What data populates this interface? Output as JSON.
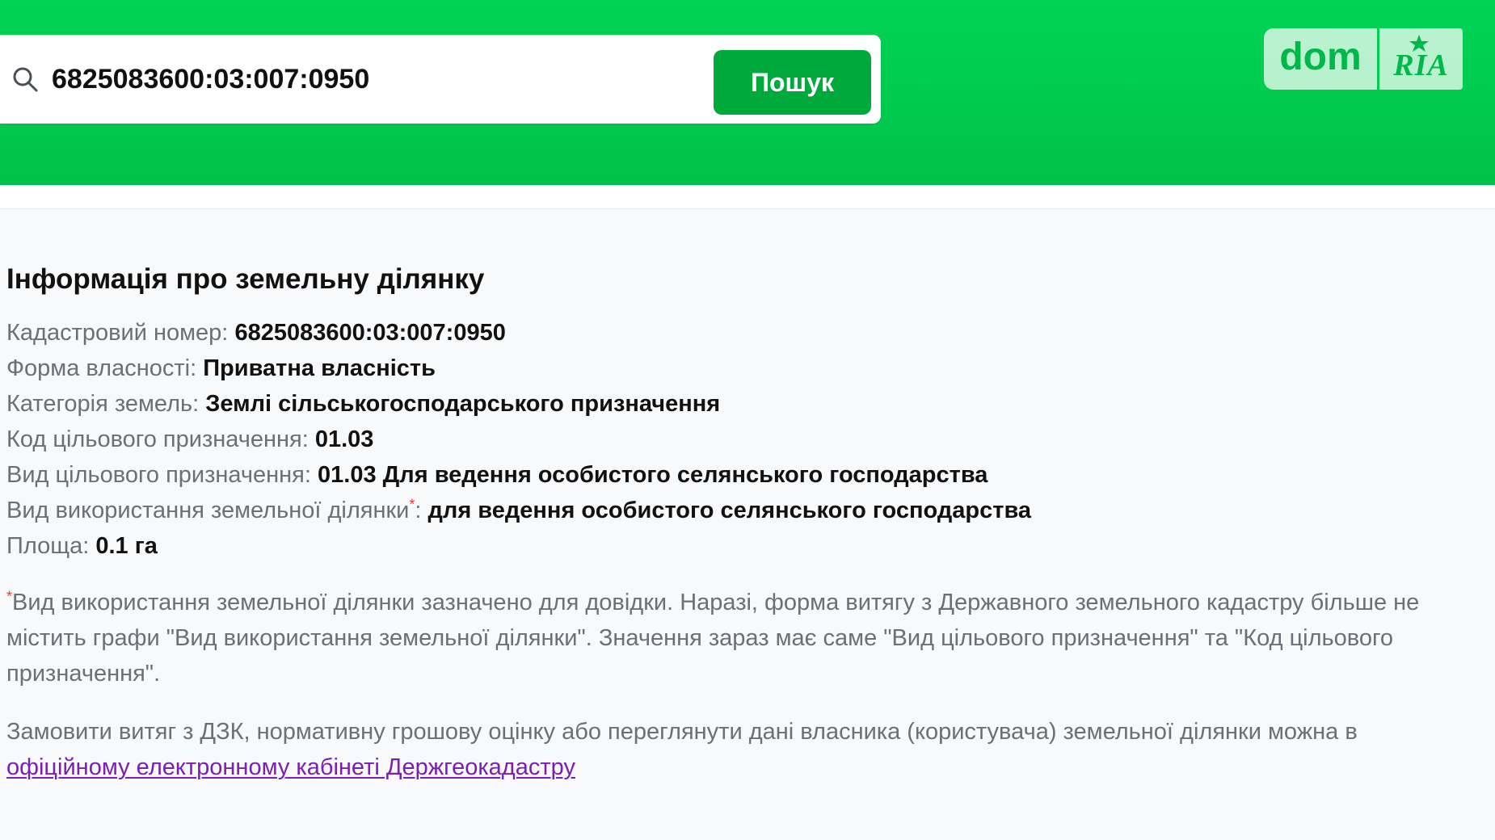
{
  "colors": {
    "header_green": "#00c94e",
    "button_green": "#00a93c",
    "link_purple": "#7a1fb4",
    "asterisk_red": "#e23b3b"
  },
  "search": {
    "value": "6825083600:03:007:0950",
    "button_label": "Пошук",
    "icon": "search-icon"
  },
  "logo": {
    "dom": "dom",
    "ria": "RIA",
    "icon": "star-icon"
  },
  "page": {
    "title": "Інформація про земельну ділянку"
  },
  "info": {
    "rows": [
      {
        "label": "Кадастровий номер: ",
        "value": "6825083600:03:007:0950"
      },
      {
        "label": "Форма власності: ",
        "value": "Приватна власність"
      },
      {
        "label": "Категорія земель: ",
        "value": "Землі сільськогосподарського призначення"
      },
      {
        "label": "Код цільового призначення: ",
        "value": "01.03"
      },
      {
        "label": "Вид цільового призначення: ",
        "value": "01.03 Для ведення особистого селянського господарства"
      },
      {
        "label": "Вид використання земельної ділянки",
        "marker": "*",
        "suffix": ": ",
        "value": "для ведення особистого селянського господарства"
      },
      {
        "label": "Площа: ",
        "value": "0.1 га"
      }
    ]
  },
  "footnote": {
    "marker": "*",
    "text": "Вид використання земельної ділянки зазначено для довідки. Наразі, форма витягу з Державного земельного кадастру більше не містить графи \"Вид використання земельної ділянки\". Значення зараз має саме \"Вид цільового призначення\" та \"Код цільового призначення\"."
  },
  "order": {
    "text": "Замовити витяг з ДЗК, нормативну грошову оцінку або переглянути дані власника (користувача) земельної ділянки можна в ",
    "link_text": "офіційному електронному кабінеті Держгеокадастру"
  }
}
